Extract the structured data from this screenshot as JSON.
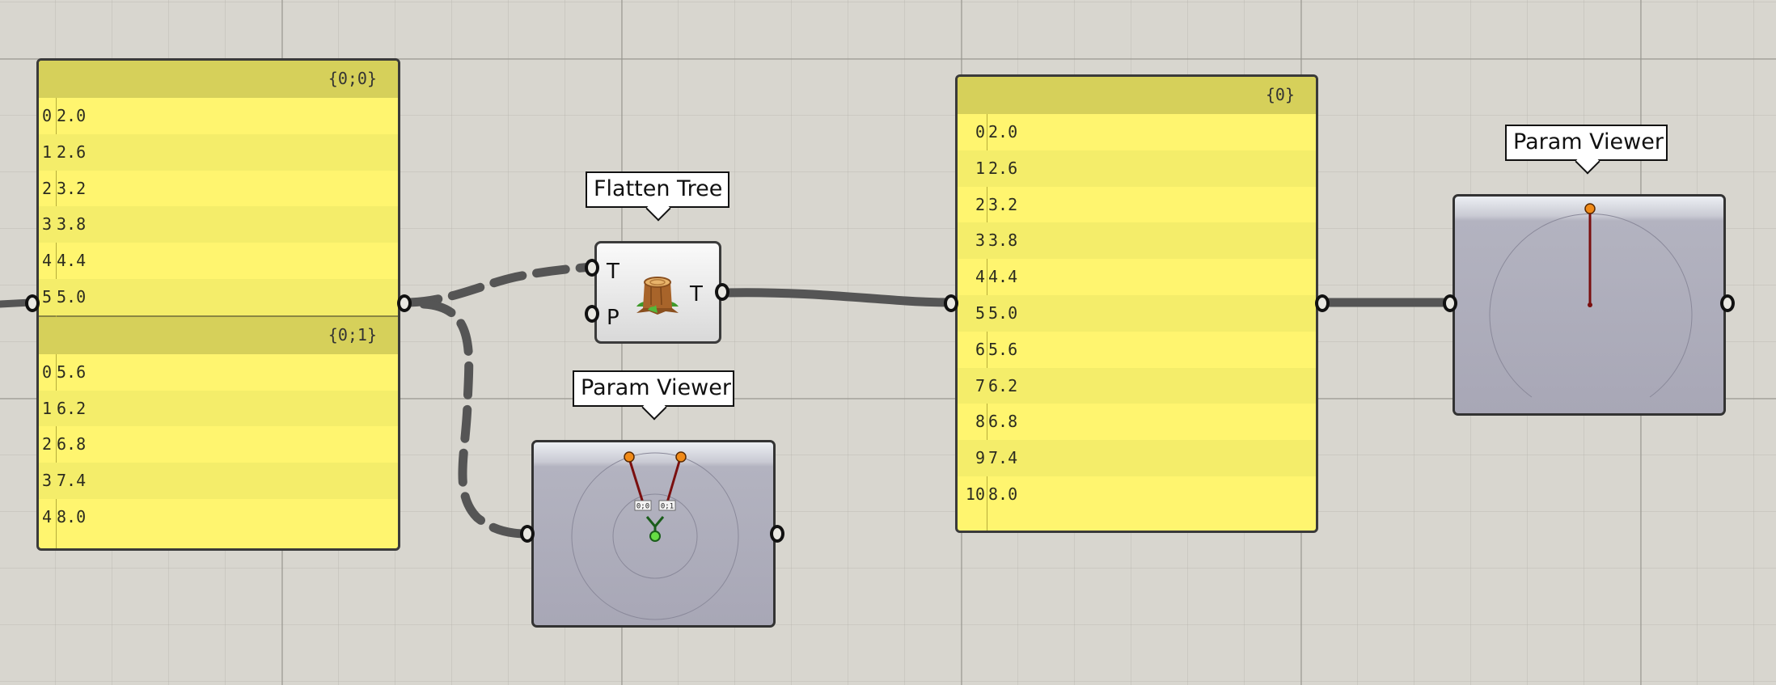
{
  "panel_left": {
    "branches": [
      {
        "path": "{0;0}",
        "items": [
          {
            "i": "0",
            "v": "2.0"
          },
          {
            "i": "1",
            "v": "2.6"
          },
          {
            "i": "2",
            "v": "3.2"
          },
          {
            "i": "3",
            "v": "3.8"
          },
          {
            "i": "4",
            "v": "4.4"
          },
          {
            "i": "5",
            "v": "5.0"
          }
        ]
      },
      {
        "path": "{0;1}",
        "items": [
          {
            "i": "0",
            "v": "5.6"
          },
          {
            "i": "1",
            "v": "6.2"
          },
          {
            "i": "2",
            "v": "6.8"
          },
          {
            "i": "3",
            "v": "7.4"
          },
          {
            "i": "4",
            "v": "8.0"
          }
        ]
      }
    ]
  },
  "flatten": {
    "tooltip": "Flatten Tree",
    "input_tree": "T",
    "input_path": "P",
    "output_tree": "T",
    "icon": "tree-stump-icon"
  },
  "param_viewer_bottom": {
    "tooltip": "Param Viewer",
    "branch_labels": [
      "0;0",
      "0;1"
    ]
  },
  "panel_right": {
    "path": "{0}",
    "items": [
      {
        "i": "0",
        "v": "2.0"
      },
      {
        "i": "1",
        "v": "2.6"
      },
      {
        "i": "2",
        "v": "3.2"
      },
      {
        "i": "3",
        "v": "3.8"
      },
      {
        "i": "4",
        "v": "4.4"
      },
      {
        "i": "5",
        "v": "5.0"
      },
      {
        "i": "6",
        "v": "5.6"
      },
      {
        "i": "7",
        "v": "6.2"
      },
      {
        "i": "8",
        "v": "6.8"
      },
      {
        "i": "9",
        "v": "7.4"
      },
      {
        "i": "10",
        "v": "8.0"
      }
    ]
  },
  "param_viewer_right": {
    "tooltip": "Param Viewer"
  },
  "colors": {
    "panel_bg": "#fff56f",
    "panel_header": "#d6d05a",
    "wire": "#555555",
    "node_orange": "#f08a18",
    "node_green": "#66dd44",
    "branch_red": "#7a0f0f"
  }
}
